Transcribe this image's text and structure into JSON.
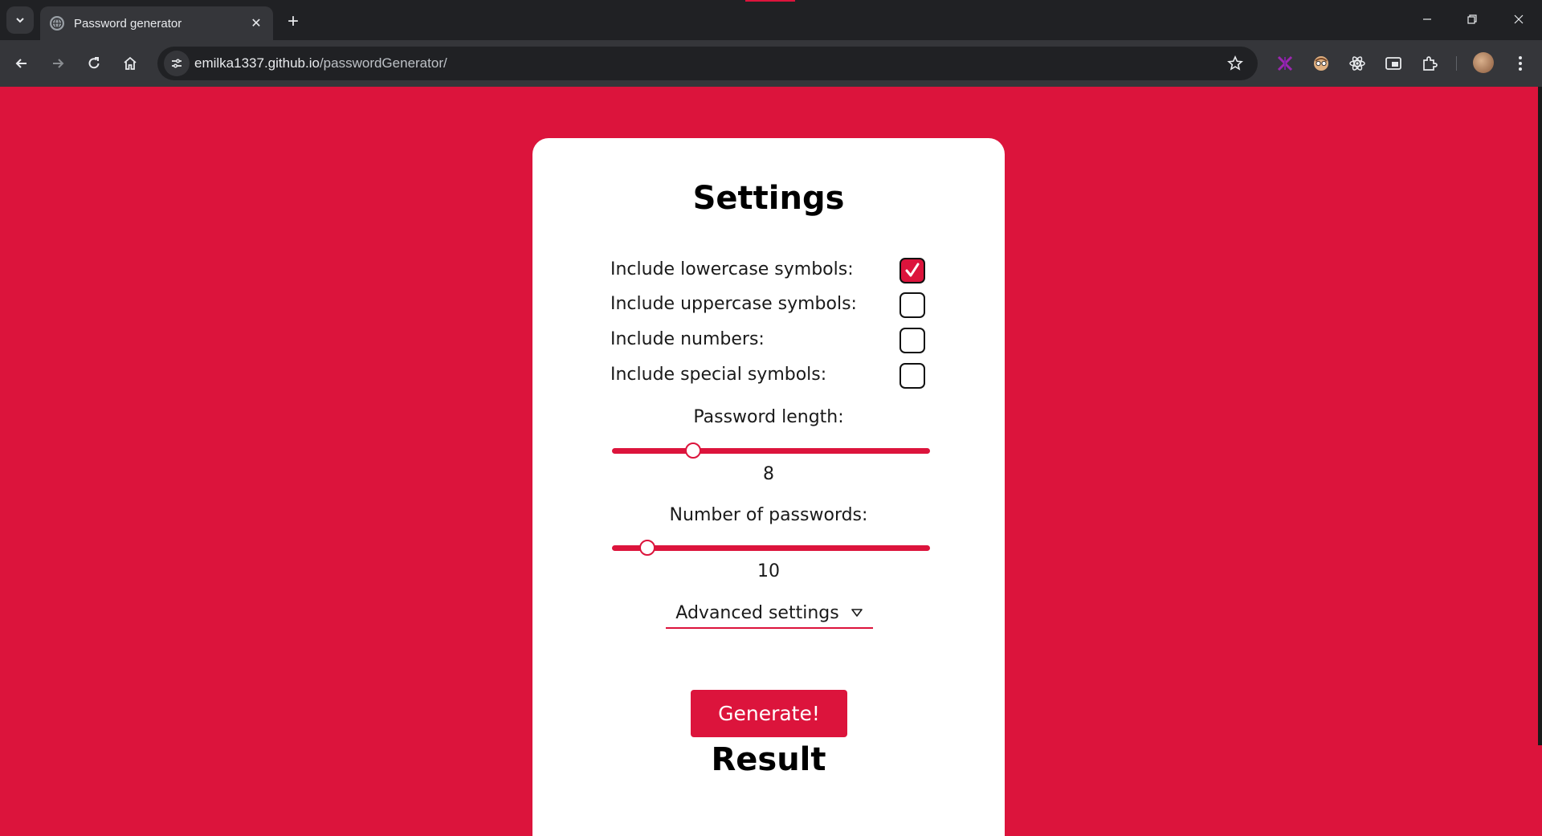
{
  "browser": {
    "tab_title": "Password generator",
    "url_host": "emilka1337.github.io",
    "url_path": "/passwordGenerator/",
    "icons": [
      "tab-list-icon",
      "globe-icon",
      "close-icon",
      "plus-icon",
      "back-icon",
      "forward-icon",
      "reload-icon",
      "home-icon",
      "site-info-icon",
      "star-icon",
      "extension-icon",
      "puzzle-icon",
      "profile-avatar",
      "menu-icon",
      "minimize-icon",
      "restore-icon",
      "window-close-icon"
    ]
  },
  "settings": {
    "title": "Settings",
    "options": [
      {
        "label": "Include lowercase symbols:",
        "checked": true
      },
      {
        "label": "Include uppercase symbols:",
        "checked": false
      },
      {
        "label": "Include numbers:",
        "checked": false
      },
      {
        "label": "Include special symbols:",
        "checked": false
      }
    ],
    "length_label": "Password length:",
    "length_value": "8",
    "count_label": "Number of passwords:",
    "count_value": "10",
    "advanced_label": "Advanced settings",
    "generate_label": "Generate!"
  },
  "result": {
    "title": "Result"
  },
  "colors": {
    "accent": "#dc143c",
    "card": "#ffffff",
    "chrome_dark": "#202124",
    "chrome_toolbar": "#35363a"
  }
}
